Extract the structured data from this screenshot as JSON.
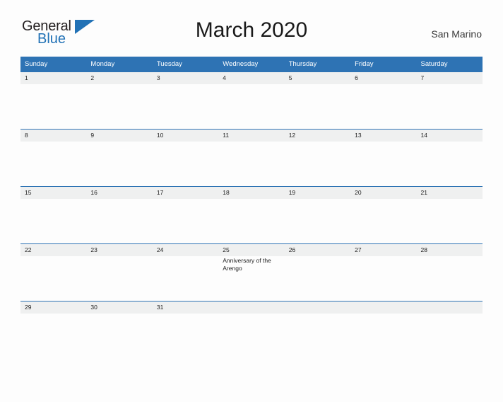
{
  "brand": {
    "name_top": "General",
    "name_bottom": "Blue",
    "flag_icon": "triangle-flag-icon",
    "color_text": "#231f20",
    "color_accent": "#2272b6"
  },
  "header": {
    "title": "March 2020",
    "subtitle": "San Marino"
  },
  "theme": {
    "header_blue": "#2e73b4",
    "row_band_gray": "#eff0f0",
    "page_background": "#fdfdfd",
    "text_dark": "#222222"
  },
  "calendar": {
    "month": "March",
    "year": "2020",
    "region": "San Marino",
    "weekday_headers": [
      "Sunday",
      "Monday",
      "Tuesday",
      "Wednesday",
      "Thursday",
      "Friday",
      "Saturday"
    ],
    "weeks": [
      {
        "days": [
          {
            "number": "1",
            "events": []
          },
          {
            "number": "2",
            "events": []
          },
          {
            "number": "3",
            "events": []
          },
          {
            "number": "4",
            "events": []
          },
          {
            "number": "5",
            "events": []
          },
          {
            "number": "6",
            "events": []
          },
          {
            "number": "7",
            "events": []
          }
        ]
      },
      {
        "days": [
          {
            "number": "8",
            "events": []
          },
          {
            "number": "9",
            "events": []
          },
          {
            "number": "10",
            "events": []
          },
          {
            "number": "11",
            "events": []
          },
          {
            "number": "12",
            "events": []
          },
          {
            "number": "13",
            "events": []
          },
          {
            "number": "14",
            "events": []
          }
        ]
      },
      {
        "days": [
          {
            "number": "15",
            "events": []
          },
          {
            "number": "16",
            "events": []
          },
          {
            "number": "17",
            "events": []
          },
          {
            "number": "18",
            "events": []
          },
          {
            "number": "19",
            "events": []
          },
          {
            "number": "20",
            "events": []
          },
          {
            "number": "21",
            "events": []
          }
        ]
      },
      {
        "days": [
          {
            "number": "22",
            "events": []
          },
          {
            "number": "23",
            "events": []
          },
          {
            "number": "24",
            "events": []
          },
          {
            "number": "25",
            "events": [
              {
                "lines": [
                  "Anniversary of the",
                  "Arengo"
                ]
              }
            ]
          },
          {
            "number": "26",
            "events": []
          },
          {
            "number": "27",
            "events": []
          },
          {
            "number": "28",
            "events": []
          }
        ]
      },
      {
        "days": [
          {
            "number": "29",
            "events": []
          },
          {
            "number": "30",
            "events": []
          },
          {
            "number": "31",
            "events": []
          },
          {
            "number": "",
            "events": []
          },
          {
            "number": "",
            "events": []
          },
          {
            "number": "",
            "events": []
          },
          {
            "number": "",
            "events": []
          }
        ]
      }
    ]
  }
}
